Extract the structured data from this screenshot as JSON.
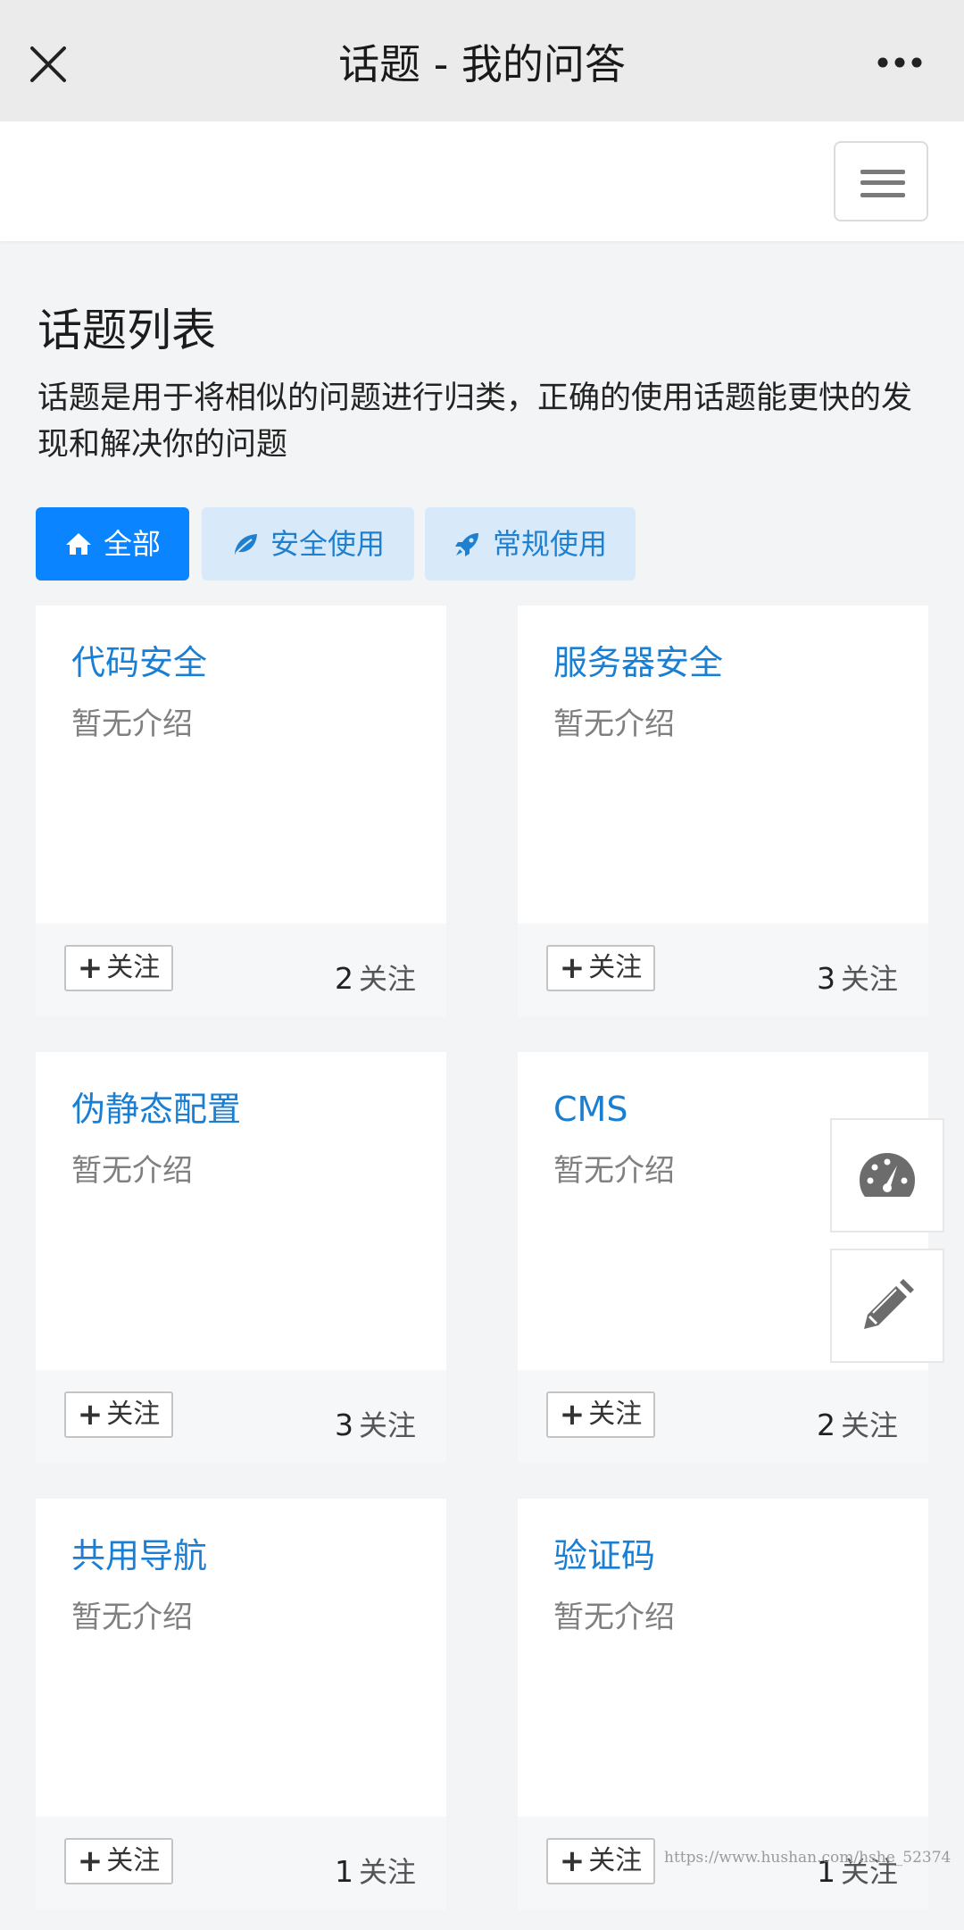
{
  "header": {
    "title": "话题 - 我的问答",
    "close_icon": "close-icon",
    "more_icon": "more-horizontal-icon"
  },
  "navbar": {
    "menu_icon": "hamburger-menu-icon"
  },
  "section": {
    "title": "话题列表",
    "description": "话题是用于将相似的问题进行归类，正确的使用话题能更快的发现和解决你的问题"
  },
  "filters": [
    {
      "label": "全部",
      "icon": "home-icon",
      "active": true
    },
    {
      "label": "安全使用",
      "icon": "leaf-icon",
      "active": false
    },
    {
      "label": "常规使用",
      "icon": "rocket-icon",
      "active": false
    }
  ],
  "topics": [
    {
      "name": "代码安全",
      "description": "暂无介绍",
      "follow_label": "关注",
      "count": "2",
      "count_label": "关注"
    },
    {
      "name": "服务器安全",
      "description": "暂无介绍",
      "follow_label": "关注",
      "count": "3",
      "count_label": "关注"
    },
    {
      "name": "伪静态配置",
      "description": "暂无介绍",
      "follow_label": "关注",
      "count": "3",
      "count_label": "关注"
    },
    {
      "name": "CMS",
      "description": "暂无介绍",
      "follow_label": "关注",
      "count": "2",
      "count_label": "关注"
    },
    {
      "name": "共用导航",
      "description": "暂无介绍",
      "follow_label": "关注",
      "count": "1",
      "count_label": "关注"
    },
    {
      "name": "验证码",
      "description": "暂无介绍",
      "follow_label": "关注",
      "count": "1",
      "count_label": "关注"
    }
  ],
  "floating": {
    "dashboard_icon": "dashboard-gauge-icon",
    "edit_icon": "pencil-icon"
  },
  "watermark": "https://www.hushan.com/hshe_52374",
  "colors": {
    "accent": "#0a84ff",
    "link": "#1a7fd3",
    "filter_inactive_bg": "#d8e9f9"
  }
}
